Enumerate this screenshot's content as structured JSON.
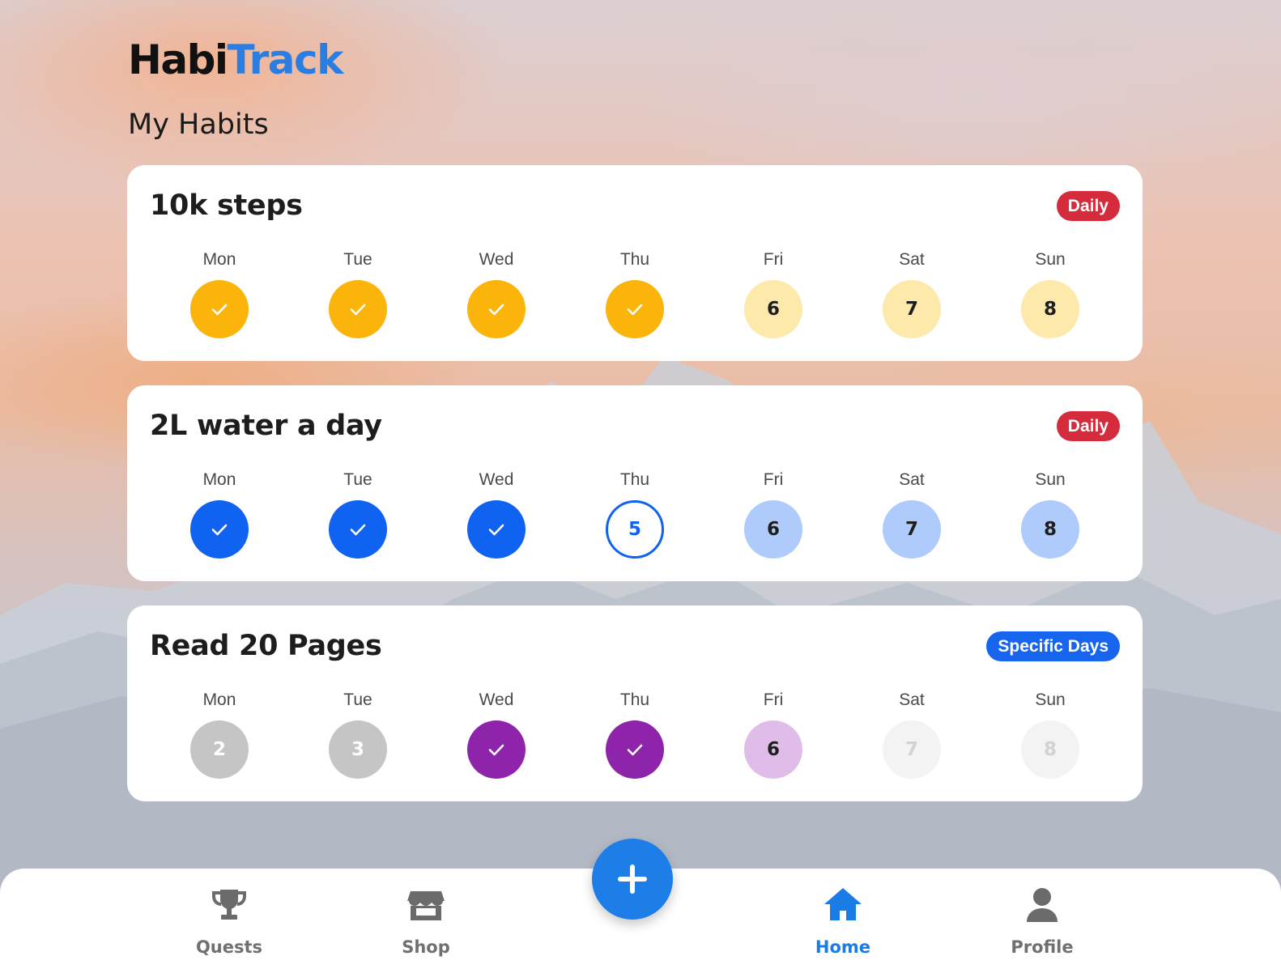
{
  "app": {
    "logo_part1": "Habi",
    "logo_part2": "Track",
    "page_title": "My Habits",
    "colors": {
      "logo_accent": "#2a7de1",
      "badge_daily": "#d42c3c",
      "badge_specific": "#1764ee",
      "nav_active": "#1b7ce6",
      "fab": "#1e7ee8"
    }
  },
  "habits": [
    {
      "title": "10k steps",
      "badge": "Daily",
      "days": [
        {
          "label": "Mon",
          "state": "done",
          "value": ""
        },
        {
          "label": "Tue",
          "state": "done",
          "value": ""
        },
        {
          "label": "Wed",
          "state": "done",
          "value": ""
        },
        {
          "label": "Thu",
          "state": "done",
          "value": ""
        },
        {
          "label": "Fri",
          "state": "upcoming",
          "value": "6"
        },
        {
          "label": "Sat",
          "state": "upcoming",
          "value": "7"
        },
        {
          "label": "Sun",
          "state": "upcoming",
          "value": "8"
        }
      ]
    },
    {
      "title": "2L water a day",
      "badge": "Daily",
      "days": [
        {
          "label": "Mon",
          "state": "done",
          "value": ""
        },
        {
          "label": "Tue",
          "state": "done",
          "value": ""
        },
        {
          "label": "Wed",
          "state": "done",
          "value": ""
        },
        {
          "label": "Thu",
          "state": "today",
          "value": "5"
        },
        {
          "label": "Fri",
          "state": "upcoming",
          "value": "6"
        },
        {
          "label": "Sat",
          "state": "upcoming",
          "value": "7"
        },
        {
          "label": "Sun",
          "state": "upcoming",
          "value": "8"
        }
      ]
    },
    {
      "title": "Read 20 Pages",
      "badge": "Specific Days",
      "days": [
        {
          "label": "Mon",
          "state": "missed",
          "value": "2"
        },
        {
          "label": "Tue",
          "state": "missed",
          "value": "3"
        },
        {
          "label": "Wed",
          "state": "done",
          "value": ""
        },
        {
          "label": "Thu",
          "state": "done",
          "value": ""
        },
        {
          "label": "Fri",
          "state": "upcoming",
          "value": "6"
        },
        {
          "label": "Sat",
          "state": "not-scheduled",
          "value": "7"
        },
        {
          "label": "Sun",
          "state": "not-scheduled",
          "value": "8"
        }
      ]
    }
  ],
  "nav": {
    "items": [
      {
        "label": "Quests",
        "icon": "trophy-icon"
      },
      {
        "label": "Shop",
        "icon": "store-icon"
      },
      {
        "label": "Home",
        "icon": "home-icon",
        "active": true
      },
      {
        "label": "Profile",
        "icon": "user-icon"
      }
    ],
    "fab_icon": "plus-icon"
  }
}
